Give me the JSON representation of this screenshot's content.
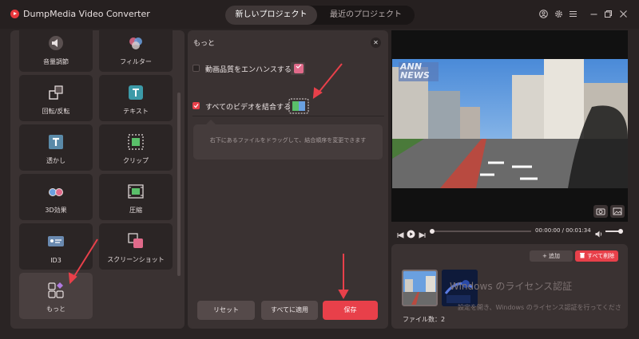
{
  "titlebar": {
    "app_title": "DumpMedia Video Converter",
    "tabs": [
      {
        "label": "新しいプロジェクト",
        "active": true
      },
      {
        "label": "最近のプロジェクト",
        "active": false
      }
    ],
    "icons": [
      "user-icon",
      "gear-icon",
      "menu-icon",
      "minimize-icon",
      "restore-icon",
      "close-icon"
    ]
  },
  "tools": [
    {
      "label": "音量調節",
      "icon": "volume-icon"
    },
    {
      "label": "フィルター",
      "icon": "filter-icon"
    },
    {
      "label": "回転/反転",
      "icon": "rotate-icon"
    },
    {
      "label": "テキスト",
      "icon": "text-icon"
    },
    {
      "label": "透かし",
      "icon": "watermark-icon"
    },
    {
      "label": "クリップ",
      "icon": "clip-icon"
    },
    {
      "label": "3D効果",
      "icon": "3d-glasses-icon"
    },
    {
      "label": "圧縮",
      "icon": "compress-icon"
    },
    {
      "label": "ID3",
      "icon": "id3-icon"
    },
    {
      "label": "スクリーンショット",
      "icon": "screenshot-icon"
    },
    {
      "label": "もっと",
      "icon": "more-icon",
      "selected": true
    }
  ],
  "settings": {
    "title": "もっと",
    "options": [
      {
        "label": "動画品質をエンハンスする",
        "checked": false
      },
      {
        "label": "すべてのビデオを結合する",
        "checked": true
      }
    ],
    "hint": "右下にあるファイルをドラッグして、結合順序を変更できます",
    "buttons": {
      "reset": "リセット",
      "apply_all": "すべてに適用",
      "save": "保存"
    }
  },
  "preview": {
    "overlay_logo": "ANN NEWS",
    "time_current": "00:00:00",
    "time_total": "00:01:34"
  },
  "file_list": {
    "add_label": "+ 追加",
    "clear_label": "すべて削除",
    "file_count_label": "ファイル数：2",
    "file_count": 2
  },
  "os_watermark": {
    "title": "Windows のライセンス認証",
    "subtitle": "設定を開き、Windows のライセンス認証を行ってくださ"
  },
  "colors": {
    "accent": "#e8404a",
    "panel": "#3a3232",
    "background": "#2a2424"
  }
}
